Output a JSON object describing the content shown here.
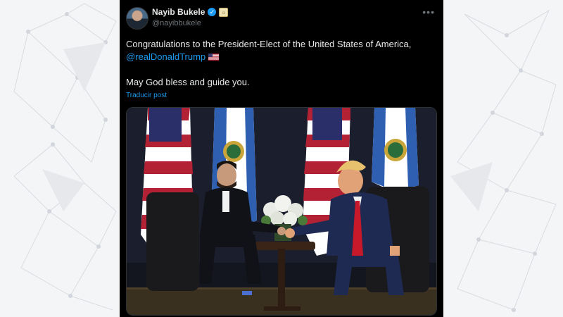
{
  "post": {
    "author_name": "Nayib Bukele",
    "author_handle": "@nayibbukele",
    "more_icon": "•••",
    "verified_icon": "✓",
    "affiliate_badge_icon": "☼",
    "text_line1": "Congratulations to the President-Elect of the United States of America,",
    "mention": "@realDonaldTrump",
    "text_line2": "May God bless and guide you.",
    "translate_label": "Traducir post"
  },
  "colors": {
    "post_background": "#000000",
    "link_blue": "#1d9bf0",
    "text": "#e7e9ea",
    "muted": "#71767b",
    "page_background": "#f4f5f7"
  },
  "icons": [
    "verified-badge-icon",
    "affiliate-badge-icon",
    "more-options-icon",
    "us-flag-emoji-icon"
  ]
}
